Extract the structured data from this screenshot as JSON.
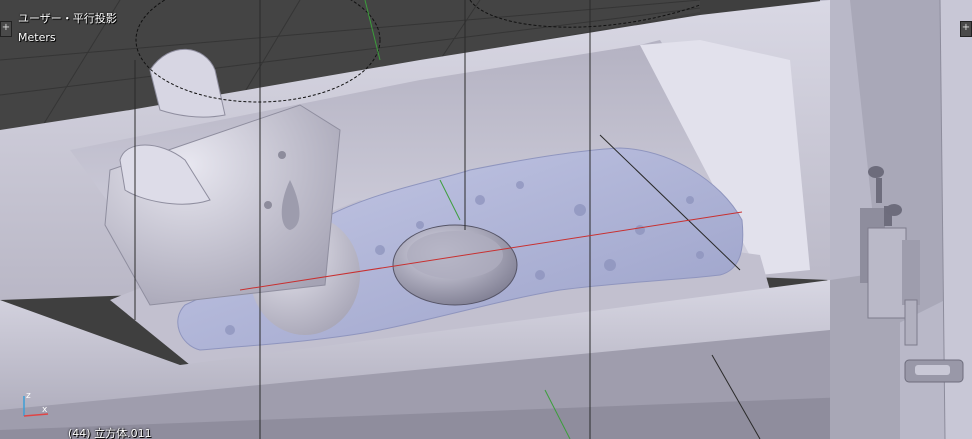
{
  "viewport": {
    "view_mode": "ユーザー・平行投影",
    "units": "Meters",
    "selected_object": "(44) 立方体.011",
    "corner_widget_symbol": "+",
    "axis_gizmo": {
      "z_label": "z",
      "x_label": "x"
    }
  },
  "colors": {
    "background": "#3d3d3d",
    "model_surface": "#c6c4d4",
    "water_surface": "#b3b8da",
    "x_axis": "#c83030",
    "z_axis": "#3c9e3c"
  }
}
